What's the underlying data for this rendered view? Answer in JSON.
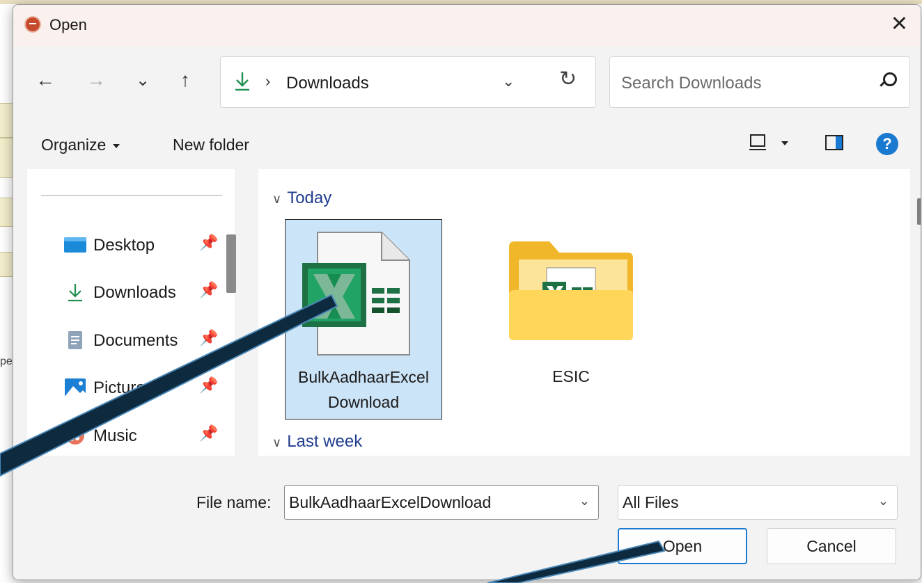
{
  "background": {
    "edge_text": "pe"
  },
  "dialog": {
    "title": "Open",
    "close_label": "✕"
  },
  "nav": {
    "back": "←",
    "forward": "→",
    "recent": "⌄",
    "up": "↑",
    "address_sep": "›",
    "address_location": "Downloads",
    "address_dropdown": "⌄",
    "refresh": "↻",
    "search_placeholder": "Search Downloads"
  },
  "commands": {
    "organize": "Organize",
    "new_folder": "New folder"
  },
  "sidebar": {
    "items": [
      {
        "label": "Desktop",
        "icon": "desktop-icon"
      },
      {
        "label": "Downloads",
        "icon": "downloads-icon"
      },
      {
        "label": "Documents",
        "icon": "documents-icon"
      },
      {
        "label": "Pictures",
        "icon": "pictures-icon"
      },
      {
        "label": "Music",
        "icon": "music-icon"
      }
    ],
    "pin_glyph": "📌"
  },
  "main": {
    "groups": [
      {
        "label": "Today",
        "chevron": "∨"
      },
      {
        "label": "Last week",
        "chevron": "∨"
      }
    ],
    "files": [
      {
        "name_line1": "BulkAadhaarExcel",
        "name_line2": "Download",
        "icon": "excel-file-icon",
        "selected": true
      },
      {
        "name_line1": "ESIC",
        "icon": "folder-icon",
        "selected": false
      }
    ]
  },
  "footer": {
    "file_name_label": "File name:",
    "file_name_value": "BulkAadhaarExcelDownload",
    "file_type_value": "All Files",
    "chevron": "⌄",
    "open_label": "Open",
    "cancel_label": "Cancel"
  },
  "colors": {
    "accent": "#1a79d0",
    "selection": "#cce4f7",
    "excel_green": "#1e7145",
    "folder_yellow": "#f5c23c",
    "annotation_arrow": "#0d2a3f"
  }
}
